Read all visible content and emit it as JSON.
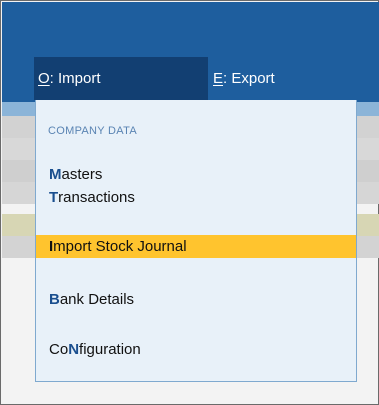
{
  "menubar": {
    "import": {
      "hotkey": "O",
      "rest": ": Import"
    },
    "export": {
      "hotkey": "E",
      "rest": ": Export"
    }
  },
  "dropdown": {
    "section_header": "COMPANY DATA",
    "items": [
      {
        "hotkey": "M",
        "rest": "asters"
      },
      {
        "hotkey": "T",
        "rest": "ransactions"
      },
      {
        "hotkey": "I",
        "rest": "mport Stock Journal"
      },
      {
        "hotkey": "B",
        "rest": "ank Details"
      },
      {
        "prefix": "Co",
        "hotkey": "N",
        "rest": "figuration"
      }
    ]
  },
  "colors": {
    "title_bar": "#1e5e9e",
    "active_menu": "#123f72",
    "dropdown_bg": "#e8f1f9",
    "highlight": "#ffc42e",
    "hotkey": "#1a4f8f"
  }
}
